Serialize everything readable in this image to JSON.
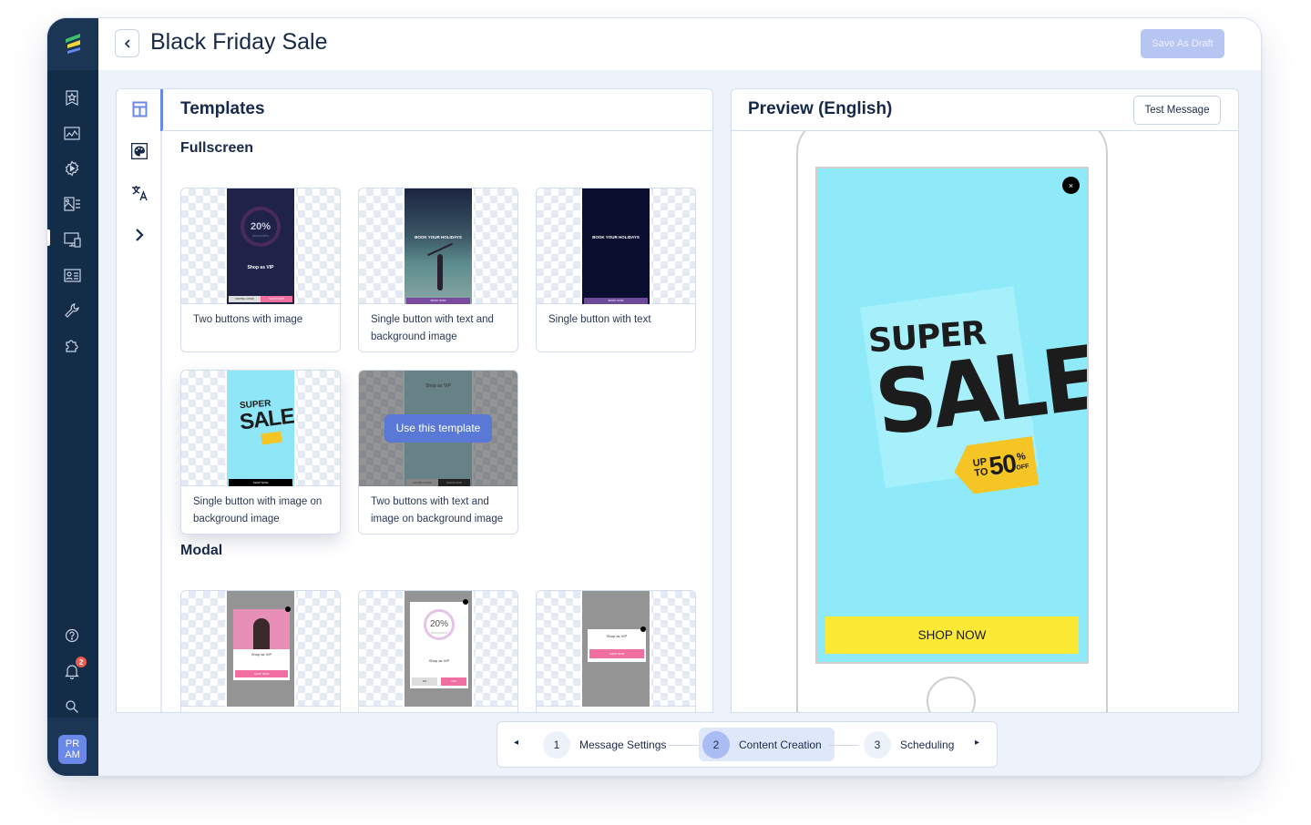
{
  "app": {
    "notification_count": "2",
    "avatar_initials_line1": "PR",
    "avatar_initials_line2": "AM"
  },
  "sidebar": {
    "items": [
      {
        "icon": "bookmark-star-icon"
      },
      {
        "icon": "analytics-chart-icon"
      },
      {
        "icon": "automation-gear-icon"
      },
      {
        "icon": "content-gallery-icon"
      },
      {
        "icon": "in-app-message-icon",
        "active": true
      },
      {
        "icon": "contact-card-icon"
      },
      {
        "icon": "wrench-icon"
      },
      {
        "icon": "puzzle-icon"
      }
    ],
    "bottom_items": [
      {
        "icon": "help-icon"
      },
      {
        "icon": "bell-icon"
      },
      {
        "icon": "search-icon"
      }
    ]
  },
  "header": {
    "title": "Black Friday Sale",
    "save_draft_label": "Save As Draft"
  },
  "templates_panel": {
    "title": "Templates",
    "tools": [
      "layout-icon",
      "palette-icon",
      "translate-icon",
      "chevron-right-icon"
    ],
    "sections": [
      {
        "title": "Fullscreen",
        "items": [
          {
            "label": "Two buttons with image",
            "thumb": {
              "big_text": "20%",
              "sub": "DISCOUNTS",
              "headline": "Shop as VIP",
              "btn1": "MAYBE LATER",
              "btn2": "SHOP NOW"
            }
          },
          {
            "label": "Single button with text and background image",
            "thumb": {
              "headline": "BOOK YOUR HOLIDAYS",
              "btn1": "BOOK NOW"
            }
          },
          {
            "label": "Single button with text",
            "thumb": {
              "headline": "BOOK YOUR HOLIDAYS",
              "btn1": "BOOK NOW"
            }
          },
          {
            "label": "Single button with image on background image",
            "thumb": {
              "headline": "SUPER",
              "big_text": "SALE",
              "btn1": "SHOP NOW"
            }
          },
          {
            "label": "Two buttons with text and image on background image",
            "thumb": {
              "headline": "Shop as VIP",
              "btn1": "MAYBE LATER",
              "btn2": "SHOP NOW"
            },
            "hover_action": "Use this template"
          }
        ]
      },
      {
        "title": "Modal",
        "items": [
          {
            "thumb": {
              "headline": "Shop as VIP",
              "btn1": "SHOP NOW"
            }
          },
          {
            "thumb": {
              "big_text": "20%",
              "sub": "DISCOUNTS",
              "headline": "Shop as VIP",
              "btn1": "NO",
              "btn2": "YES"
            }
          },
          {
            "thumb": {
              "headline": "Shop as VIP",
              "btn1": "SHOP NOW"
            }
          }
        ]
      }
    ]
  },
  "preview_panel": {
    "title": "Preview (English)",
    "test_button_label": "Test Message",
    "creative": {
      "line1": "SUPER",
      "line2": "SALE",
      "tag_prefix_top": "UP",
      "tag_prefix_bottom": "TO",
      "tag_value": "50",
      "tag_suffix_top": "%",
      "tag_suffix_bottom": "OFF",
      "cta_label": "SHOP NOW",
      "close_glyph": "×",
      "background_color": "#8eeaf9",
      "cta_color": "#fbe936",
      "tag_color": "#f5c525"
    }
  },
  "stepper": {
    "steps": [
      {
        "num": "1",
        "label": "Message Settings",
        "active": false
      },
      {
        "num": "2",
        "label": "Content Creation",
        "active": true
      },
      {
        "num": "3",
        "label": "Scheduling",
        "active": false
      }
    ],
    "prev_glyph": "◂",
    "next_glyph": "▸"
  }
}
